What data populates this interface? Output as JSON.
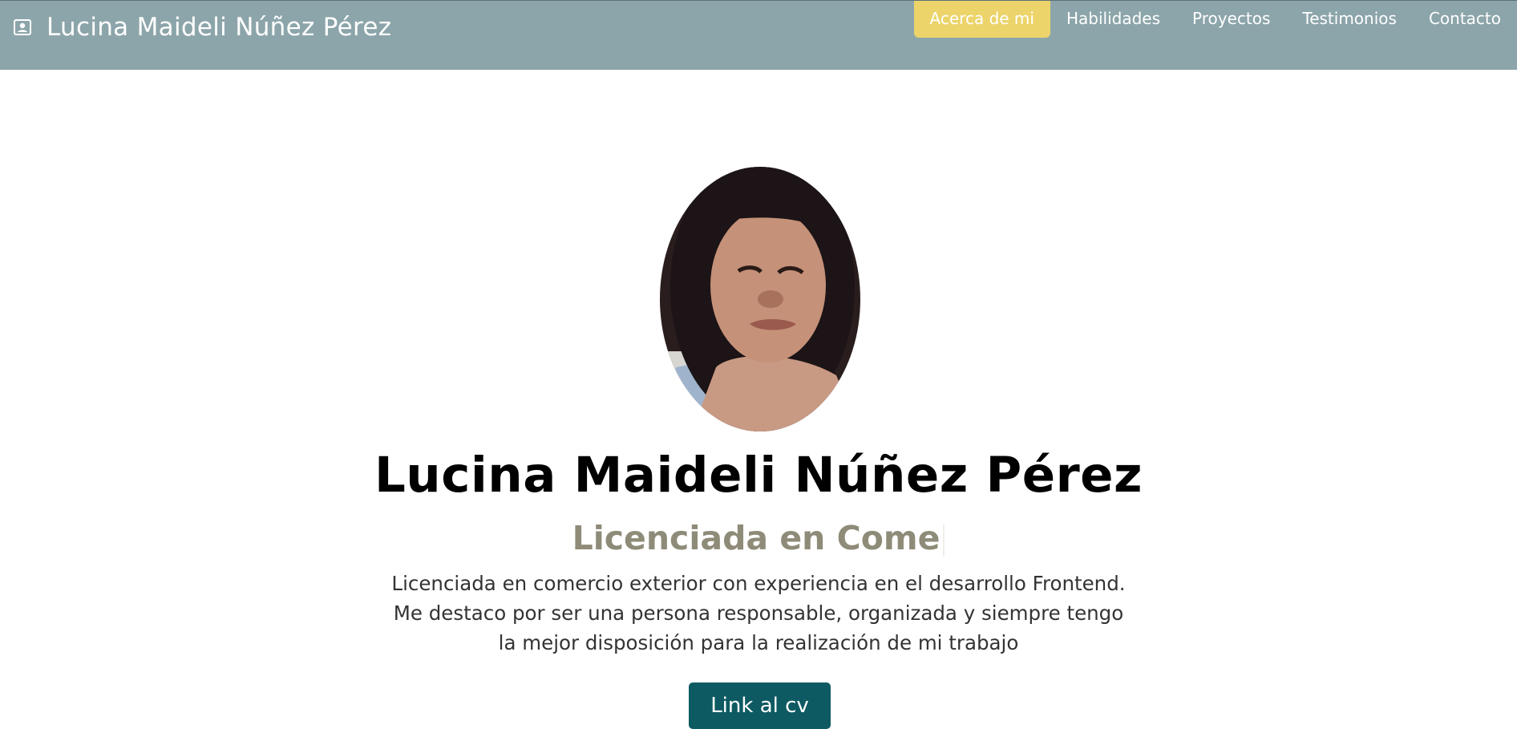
{
  "navbar": {
    "brand_icon": "person-badge-icon",
    "brand": "Lucina Maideli Núñez Pérez",
    "links": [
      {
        "label": "Acerca de mi",
        "active": true
      },
      {
        "label": "Habilidades",
        "active": false
      },
      {
        "label": "Proyectos",
        "active": false
      },
      {
        "label": "Testimonios",
        "active": false
      },
      {
        "label": "Contacto",
        "active": false
      }
    ]
  },
  "hero": {
    "name": "Lucina Maideli Núñez Pérez",
    "role_typed": "Licenciada en Come",
    "description_lines": [
      "Licenciada en comercio exterior con experiencia en el desarrollo Frontend.",
      "Me destaco por ser una persona responsable, organizada y siempre tengo",
      "la mejor disposición para la realización de mi trabajo"
    ],
    "cv_button": "Link al cv"
  },
  "colors": {
    "navbar_bg": "#8ca5aa",
    "active_link_bg": "#ecd46a",
    "role_text": "#8e8b78",
    "button_bg": "#0e5a63"
  }
}
